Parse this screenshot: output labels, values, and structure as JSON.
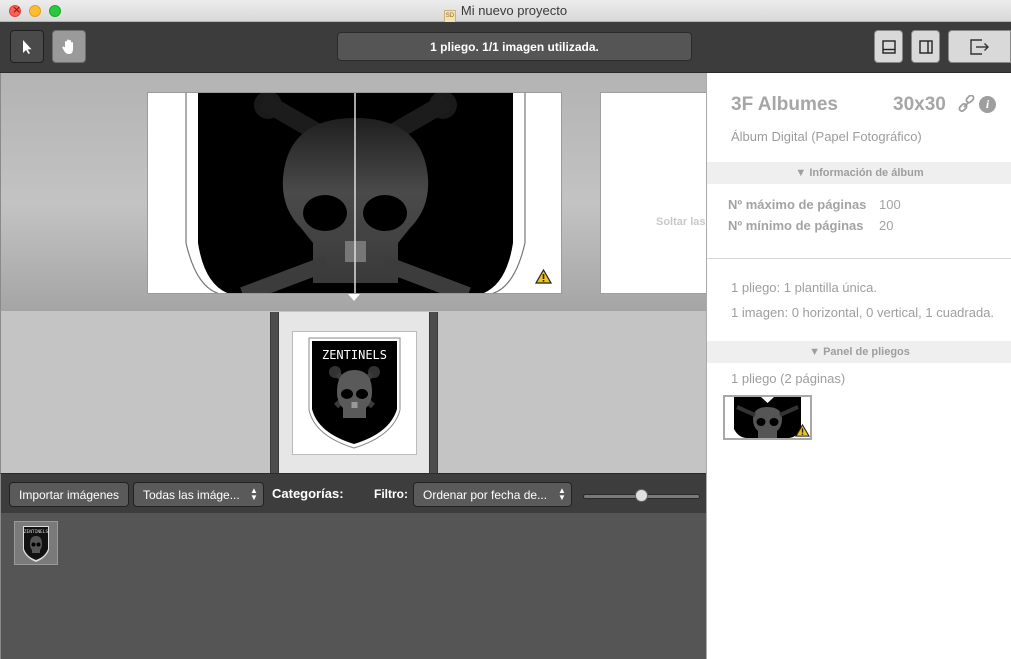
{
  "window": {
    "title": "Mi nuevo proyecto",
    "doc_icon_text": "SD"
  },
  "toolbar": {
    "status": "1 pliego. 1/1 imagen utilizada."
  },
  "canvas": {
    "drop_hint": "Soltar las"
  },
  "design": {
    "logo_text": "ZENTINELS",
    "thumb_logo_text": "ZENTINELS"
  },
  "browser": {
    "import_label": "Importar imágenes",
    "filter_all_label": "Todas las imáge...",
    "categories_label": "Categorías:",
    "filter_label": "Filtro:",
    "sort_label": "Ordenar por fecha de...",
    "zoom_level": 0.5
  },
  "panel": {
    "title": "3F Albumes",
    "size": "30x30",
    "subtitle": "Álbum Digital (Papel Fotográfico)",
    "album_info_header": "▼ Información de álbum",
    "max_pages_label": "Nº máximo de páginas",
    "max_pages_value": "100",
    "min_pages_label": "Nº mínimo de páginas",
    "min_pages_value": "20",
    "template_summary": "1 pliego: 1 plantilla única.",
    "image_summary": "1 imagen: 0 horizontal, 0 vertical, 1 cuadrada.",
    "spreads_header": "▼ Panel de pliegos",
    "spreads_count": "1 pliego (2 páginas)"
  },
  "colors": {
    "accent_warning": "#f2c318",
    "toolbar_bg": "#3c3c3c",
    "panel_text": "#9e9e9e"
  },
  "icons": {
    "select_tool": "arrow-pointer-icon",
    "pan_tool": "hand-icon",
    "bottom_panel_toggle": "bottom-panel-icon",
    "side_panel_toggle": "side-panel-icon",
    "export": "export-icon",
    "link": "link-icon",
    "info": "info-icon",
    "warning": "warning-icon"
  }
}
